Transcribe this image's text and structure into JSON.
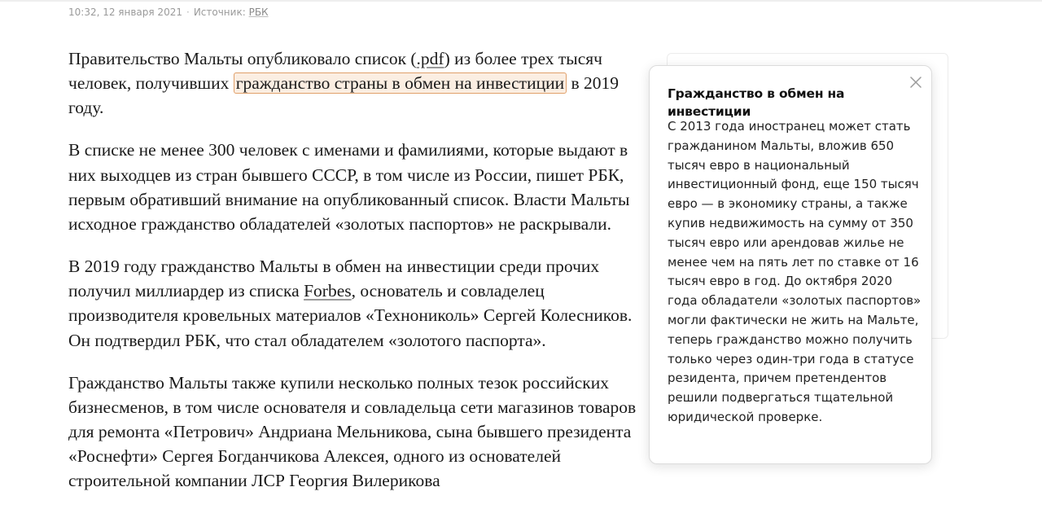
{
  "meta": {
    "datetime": "10:32, 12 января 2021",
    "separator": "·",
    "source_label": "Источник:",
    "source_link": "РБК"
  },
  "article": {
    "p1": {
      "a": "Правительство Мальты опубликовало список (",
      "pdf_link": ".pdf",
      "b": ") из более трех тысяч человек, получивших ",
      "highlight": "гражданство страны в обмен на инвестиции",
      "c": " в 2019 году."
    },
    "p2": "В списке не менее 300 человек с именами и фамилиями, которые выдают в них выходцев из стран бывшего СССР, в том числе из России, пишет РБК, первым обративший внимание на опубликованный список. Власти Мальты исходное гражданство обладателей «золотых паспортов» не раскрывали.",
    "p3": {
      "a": "В 2019 году гражданство Мальты в обмен на инвестиции среди прочих получил миллиардер из списка ",
      "forbes_link": "Forbes",
      "b": ", основатель и совладелец производителя кровельных материалов «Технониколь» Сергей Колесников. Он подтвердил РБК, что стал обладателем «золотого паспорта»."
    },
    "p4": "Гражданство Мальты также купили несколько полных тезок российских бизнесменов, в том числе основателя и совладельца сети магазинов товаров для ремонта «Петрович» Андриана Мельникова, сына бывшего президента «Роснефти» Сергея Богданчикова Алексея, одного из основателей строительной компании ЛСР Георгия Вилерикова"
  },
  "popup": {
    "title": "Гражданство в обмен на инвестиции",
    "body": "С 2013 года иностранец может стать гражданином Мальты, вложив 650 тысяч евро в национальный инвестиционный фонд, еще 150 тысяч евро — в экономику страны, а также купив недвижимость на сумму от 350 тысяч евро или арендовав жилье не менее чем на пять лет по ставке от 16 тысяч евро в год. До октября 2020 года обладатели «золотых паспортов» могли фактически не жить на Мальте, теперь гражданство можно получить только через один-три года в статусе резидента, причем претендентов решили подвергаться тщательной юридической проверке.",
    "close_icon": "close-icon"
  }
}
